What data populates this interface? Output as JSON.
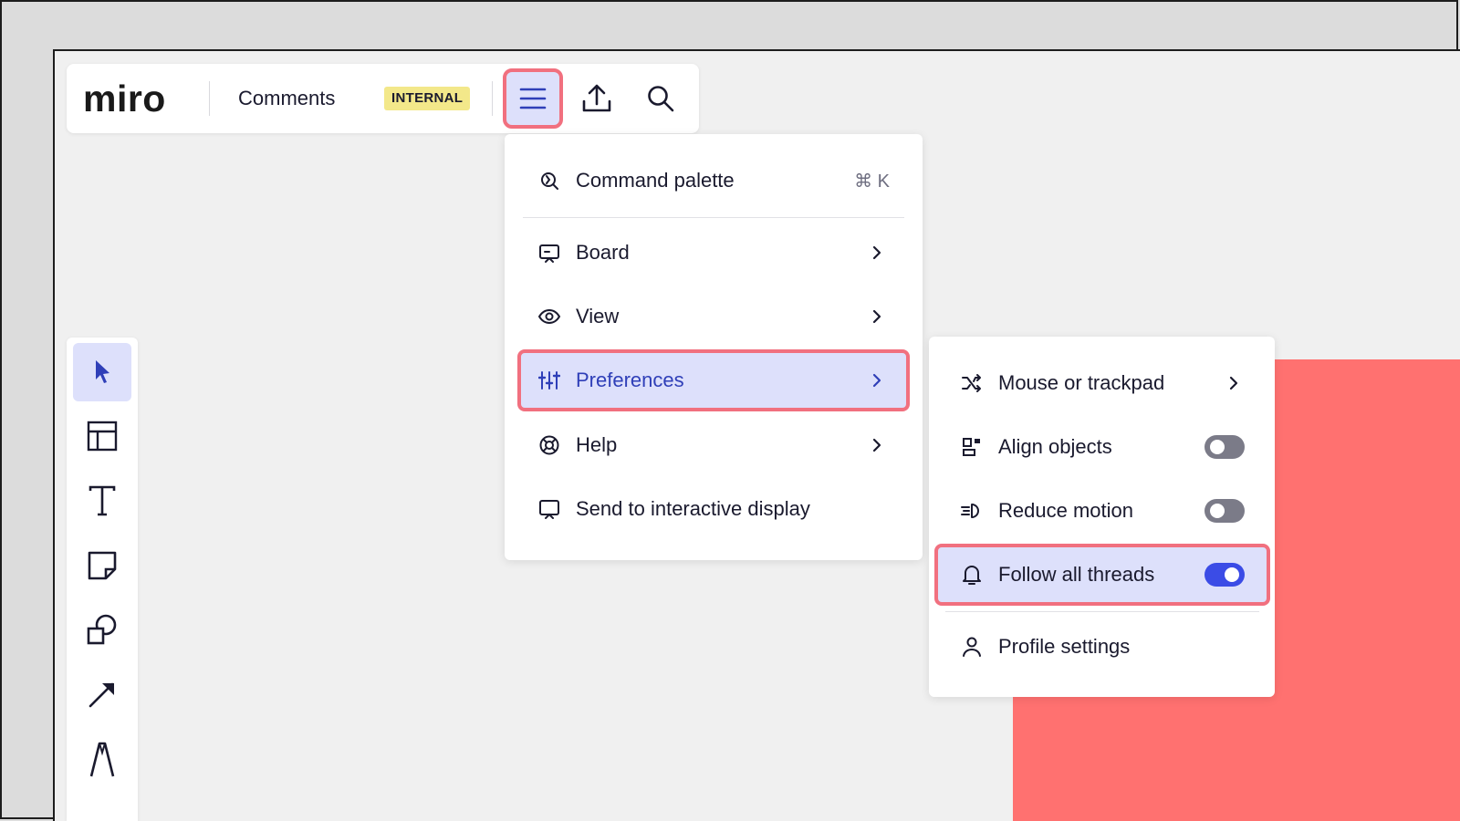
{
  "header": {
    "logo": "miro",
    "board_title": "Comments",
    "badge": "INTERNAL",
    "buttons": [
      {
        "icon": "hamburger-menu-icon",
        "active": true
      },
      {
        "icon": "upload-icon"
      },
      {
        "icon": "search-icon"
      }
    ]
  },
  "main_menu": {
    "items": [
      {
        "label": "Command palette",
        "icon": "command-palette-icon",
        "shortcut": "⌘ K"
      },
      {
        "label": "Board",
        "icon": "board-icon",
        "has_submenu": true
      },
      {
        "label": "View",
        "icon": "eye-icon",
        "has_submenu": true
      },
      {
        "label": "Preferences",
        "icon": "sliders-icon",
        "has_submenu": true,
        "highlighted": true
      },
      {
        "label": "Help",
        "icon": "lifebuoy-icon",
        "has_submenu": true
      },
      {
        "label": "Send to interactive display",
        "icon": "display-icon"
      }
    ]
  },
  "preferences_menu": {
    "items": [
      {
        "label": "Mouse or trackpad",
        "icon": "shuffle-icon",
        "has_submenu": true
      },
      {
        "label": "Align objects",
        "icon": "align-objects-icon",
        "toggle": false
      },
      {
        "label": "Reduce motion",
        "icon": "reduce-motion-icon",
        "toggle": false
      },
      {
        "label": "Follow all threads",
        "icon": "bell-icon",
        "toggle": true,
        "highlighted": true
      },
      {
        "label": "Profile settings",
        "icon": "user-icon"
      }
    ]
  },
  "left_toolbar": {
    "tools": [
      {
        "icon": "select-cursor-icon",
        "active": true
      },
      {
        "icon": "templates-icon"
      },
      {
        "icon": "text-icon"
      },
      {
        "icon": "sticky-note-icon"
      },
      {
        "icon": "shapes-icon"
      },
      {
        "icon": "arrow-line-icon"
      },
      {
        "icon": "pen-icon"
      }
    ]
  },
  "colors": {
    "accent": "#3b4ce6",
    "highlight_bg": "#dde0fb",
    "highlight_outline": "#f1707f",
    "canvas_shape": "#ff7170",
    "badge_bg": "#f3e88a"
  }
}
